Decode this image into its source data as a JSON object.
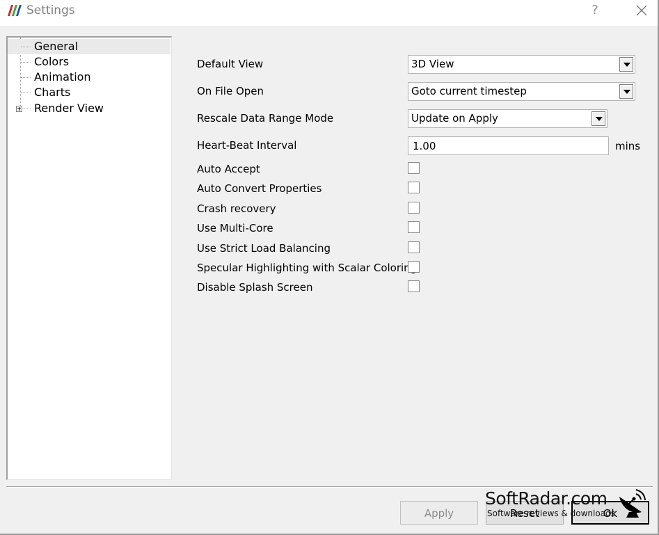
{
  "window": {
    "title": "Settings",
    "help_label": "?"
  },
  "tree": {
    "items": [
      {
        "label": "General",
        "selected": true,
        "expandable": false
      },
      {
        "label": "Colors",
        "selected": false,
        "expandable": false
      },
      {
        "label": "Animation",
        "selected": false,
        "expandable": false
      },
      {
        "label": "Charts",
        "selected": false,
        "expandable": false
      },
      {
        "label": "Render View",
        "selected": false,
        "expandable": true
      }
    ]
  },
  "general": {
    "default_view": {
      "label": "Default View",
      "value": "3D View"
    },
    "on_file_open": {
      "label": "On File Open",
      "value": "Goto current timestep"
    },
    "rescale_mode": {
      "label": "Rescale Data Range Mode",
      "value": "Update on Apply"
    },
    "heartbeat": {
      "label": "Heart-Beat Interval",
      "value": "1.00",
      "unit": "mins"
    },
    "checkboxes": [
      {
        "label": "Auto Accept",
        "checked": false
      },
      {
        "label": "Auto Convert Properties",
        "checked": false
      },
      {
        "label": "Crash recovery",
        "checked": false
      },
      {
        "label": "Use Multi-Core",
        "checked": false
      },
      {
        "label": "Use Strict Load Balancing",
        "checked": false
      },
      {
        "label": "Specular Highlighting with Scalar Coloring",
        "checked": false
      },
      {
        "label": "Disable Splash Screen",
        "checked": false
      }
    ]
  },
  "buttons": {
    "apply": "Apply",
    "reset": "Reset",
    "ok": "Ok"
  },
  "watermark": {
    "title": "SoftRadar.com",
    "subtitle": "Software reviews & downloads"
  },
  "colors": {
    "logo_red": "#d9242b",
    "logo_green": "#3aa842",
    "logo_blue": "#2a4fb5"
  }
}
